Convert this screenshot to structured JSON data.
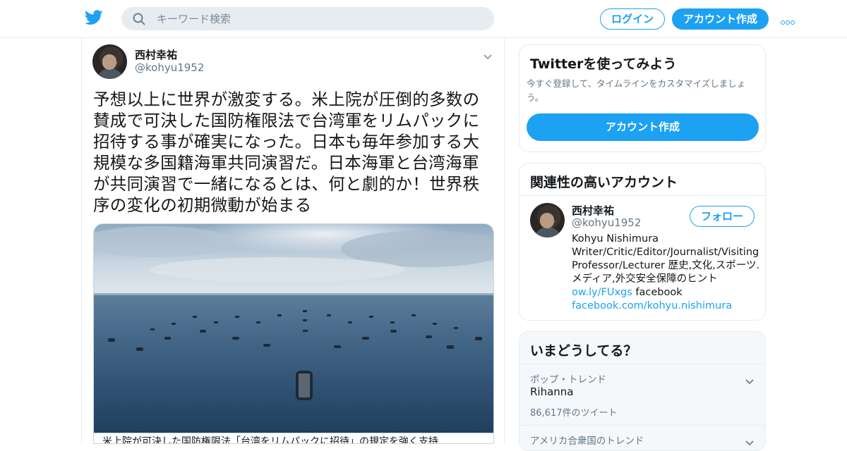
{
  "header": {
    "search_placeholder": "キーワード検索",
    "login_label": "ログイン",
    "signup_label": "アカウント作成",
    "logo_icon": "twitter-bird-icon",
    "more_icon": "more-dots-icon"
  },
  "tweet": {
    "author_name": "西村幸祐",
    "author_handle": "@kohyu1952",
    "text": "予想以上に世界が激変する。米上院が圧倒的多数の賛成で可決した国防権限法で台湾軍をリムパックに招待する事が確実になった。日本も毎年参加する大規模な多国籍海軍共同演習だ。日本海軍と台湾海軍が共同演習で一緒になるとは、何と劇的か！世界秩序の変化の初期微動が始まる",
    "media_caption": "米上院が可決した国防権限法「台湾をリムパックに招待」の規定を強く支持"
  },
  "signup_card": {
    "title": "Twitterを使ってみよう",
    "description": "今すぐ登録して、タイムラインをカスタマイズしましょう。",
    "button_label": "アカウント作成"
  },
  "related_card": {
    "title": "関連性の高いアカウント",
    "account_name": "西村幸祐",
    "account_handle": "@kohyu1952",
    "follow_label": "フォロー",
    "bio_text": "Kohyu Nishimura Writer/Critic/Editor/Journalist/Visiting Professor/Lecturer 歴史,文化,スポーツ.メディア,外交安全保障のヒント",
    "bio_link1": "ow.ly/FUxgs",
    "bio_mid": " facebook",
    "bio_link2": "facebook.com/kohyu.nishimura"
  },
  "trends_card": {
    "title": "いまどうしてる？",
    "trends": [
      {
        "context": "ポップ・トレンド",
        "name": "Rihanna",
        "count": "86,617件のツイート"
      },
      {
        "context": "アメリカ合衆国のトレンド",
        "name": "",
        "count": ""
      }
    ]
  },
  "colors": {
    "brand_blue": "#1da1f2",
    "text_primary": "#14171a",
    "text_secondary": "#657786",
    "border": "#e6ecf0"
  }
}
